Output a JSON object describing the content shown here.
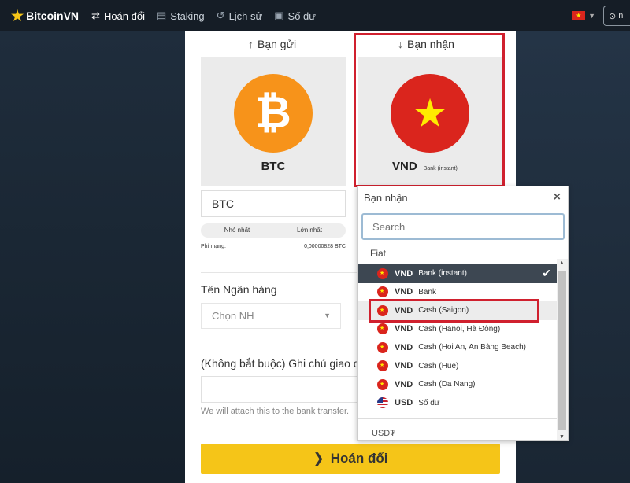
{
  "nav": {
    "brand": "BitcoinVN",
    "items": [
      {
        "label": "Hoán đổi",
        "icon": "swap-icon"
      },
      {
        "label": "Staking",
        "icon": "coins-icon"
      },
      {
        "label": "Lịch sử",
        "icon": "history-icon"
      },
      {
        "label": "Số dư",
        "icon": "wallet-icon"
      }
    ],
    "user_initial": "n",
    "language_flag": "vietnam-flag"
  },
  "send": {
    "label": "Bạn gửi",
    "currency": "BTC",
    "amount_value": "BTC",
    "min_label": "Nhỏ nhất",
    "max_label": "Lớn nhất",
    "fee_label": "Phí mạng:",
    "fee_value": "0,00000828 BTC"
  },
  "receive": {
    "label": "Bạn nhận",
    "currency": "VND",
    "method": "Bank (instant)"
  },
  "bank": {
    "label": "Tên Ngân hàng",
    "placeholder": "Chọn NH"
  },
  "note": {
    "label": "(Không bắt buộc) Ghi chú giao dịch",
    "help": "We will attach this to the bank transfer."
  },
  "swap_button": "Hoán đổi",
  "dropdown": {
    "title": "Bạn nhận",
    "search_placeholder": "Search",
    "group": "Fiat",
    "options": [
      {
        "currency": "VND",
        "method": "Bank (instant)",
        "selected": true
      },
      {
        "currency": "VND",
        "method": "Bank"
      },
      {
        "currency": "VND",
        "method": "Cash (Saigon)",
        "highlighted": true
      },
      {
        "currency": "VND",
        "method": "Cash (Hanoi, Hà Đông)"
      },
      {
        "currency": "VND",
        "method": "Cash (Hoi An, An Bàng Beach)"
      },
      {
        "currency": "VND",
        "method": "Cash (Hue)"
      },
      {
        "currency": "VND",
        "method": "Cash (Da Nang)"
      },
      {
        "currency": "USD",
        "method": "Số dư"
      }
    ],
    "next_group": "USD₮"
  },
  "colors": {
    "accent": "#f5c518",
    "highlight_border": "#d0202e",
    "nav_bg": "#151d26"
  }
}
